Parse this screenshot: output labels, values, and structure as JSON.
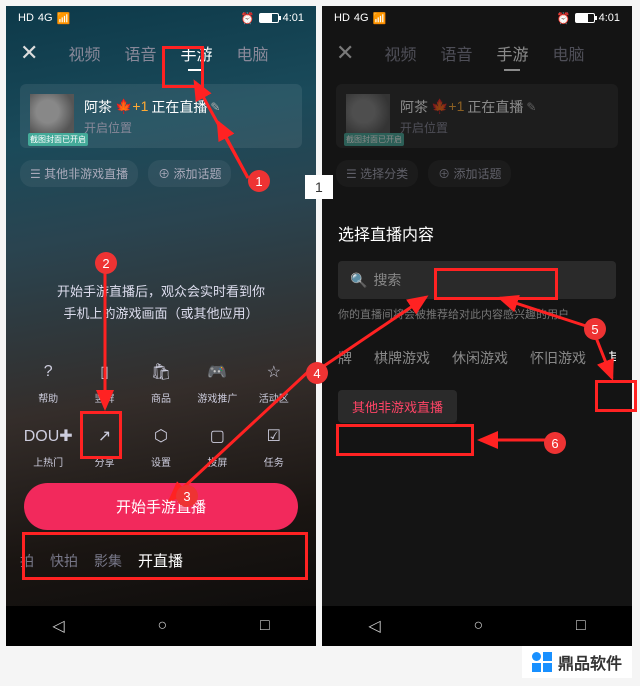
{
  "status": {
    "hd": "HD",
    "net": "4G",
    "alarm": "⏰",
    "time": "4:01"
  },
  "tabs": {
    "video": "视频",
    "voice": "语音",
    "mobile_game": "手游",
    "pc": "电脑"
  },
  "card": {
    "user": "阿茶",
    "badge": "🍁+1",
    "status": "正在直播",
    "sub": "开启位置",
    "avatar_badge": "截图封面已开启"
  },
  "chips_left": {
    "cat": "其他非游戏直播",
    "topic": "⊕ 添加话题"
  },
  "chips_right": {
    "cat": "选择分类",
    "topic": "⊕ 添加话题"
  },
  "mid_text_1": "开始手游直播后，观众会实时看到你",
  "mid_text_2": "手机上的游戏画面（或其他应用）",
  "icons_row1": [
    {
      "name": "help-icon",
      "glyph": "?",
      "label": "帮助"
    },
    {
      "name": "portrait-icon",
      "glyph": "▯",
      "label": "竖屏"
    },
    {
      "name": "shop-icon",
      "glyph": "🛍",
      "label": "商品"
    },
    {
      "name": "game-icon",
      "glyph": "🎮",
      "label": "游戏推广"
    },
    {
      "name": "activity-icon",
      "glyph": "☆",
      "label": "活动区"
    }
  ],
  "icons_row2": [
    {
      "name": "dou-icon",
      "glyph": "DOU✚",
      "label": "上热门"
    },
    {
      "name": "share-icon",
      "glyph": "↗",
      "label": "分享"
    },
    {
      "name": "settings-icon",
      "glyph": "⬡",
      "label": "设置"
    },
    {
      "name": "cast-icon",
      "glyph": "▢",
      "label": "投屏"
    },
    {
      "name": "task-icon",
      "glyph": "☑",
      "label": "任务"
    }
  ],
  "start_btn": "开始手游直播",
  "bottom_tabs": {
    "shoot": "拍",
    "quick": "快拍",
    "film": "影集",
    "live": "开直播"
  },
  "right_panel": {
    "title": "选择直播内容",
    "search_placeholder": "搜索",
    "hint": "你的直播间将会被推荐给对此内容感兴趣的用户",
    "cats": [
      "牌",
      "棋牌游戏",
      "休闲游戏",
      "怀旧游戏",
      "其他"
    ],
    "result": "其他非游戏直播"
  },
  "badges": {
    "b1": "1",
    "b2": "2",
    "b3": "3",
    "b4": "4",
    "b5": "5",
    "b6": "6"
  },
  "annotation": "1",
  "watermark": "鼎品软件"
}
